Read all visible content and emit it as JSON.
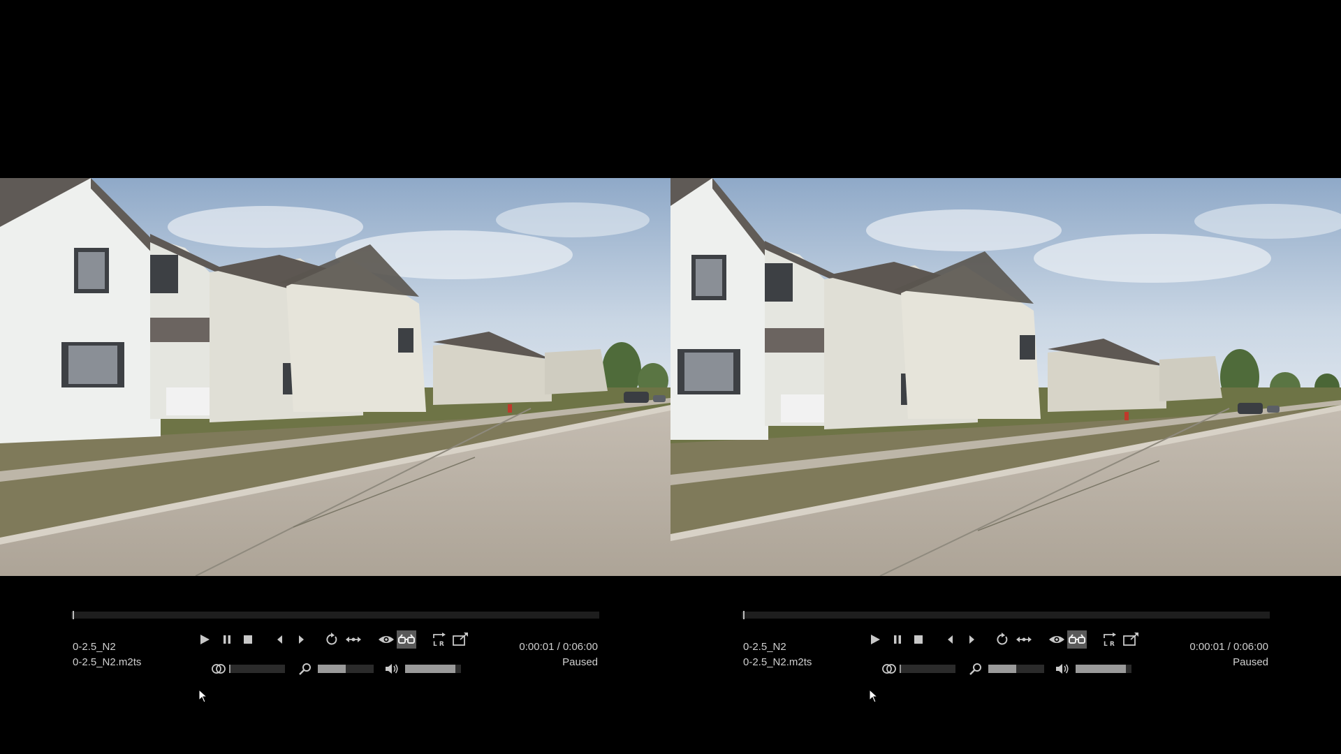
{
  "players": [
    {
      "id": "left",
      "title": "0-2.5_N2",
      "filename": "0-2.5_N2.m2ts",
      "time": "0:00:01 / 0:06:00",
      "status": "Paused",
      "progress": 0.003,
      "stereo_level": 0.02,
      "zoom_level": 0.5,
      "volume_level": 0.9
    },
    {
      "id": "right",
      "title": "0-2.5_N2",
      "filename": "0-2.5_N2.m2ts",
      "time": "0:00:01 / 0:06:00",
      "status": "Paused",
      "progress": 0.003,
      "stereo_level": 0.02,
      "zoom_level": 0.5,
      "volume_level": 0.9
    }
  ],
  "controls": {
    "buttons": [
      "play-icon",
      "pause-icon",
      "stop-icon",
      "step-back-icon",
      "step-forward-icon",
      "loop-icon",
      "swap-eyes-icon",
      "eye-icon",
      "anaglyph-icon",
      "lr-mode-icon",
      "fullscreen-icon"
    ],
    "sliders": [
      "stereo-depth-icon",
      "zoom-icon",
      "volume-icon"
    ]
  },
  "colors": {
    "background": "#000000",
    "text": "#d0d0d0",
    "icon": "#c8c8c8",
    "track": "#2b2b2b",
    "fill": "#9a9a9a"
  }
}
